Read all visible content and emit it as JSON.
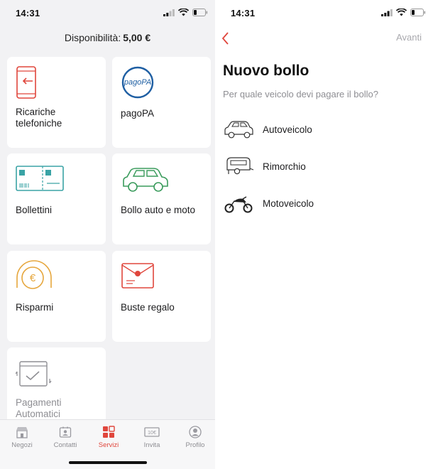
{
  "left_screen": {
    "status_bar": {
      "time": "14:31"
    },
    "balance": {
      "label": "Disponibilità:",
      "amount": "5,00 €"
    },
    "services": [
      {
        "id": "ricariche",
        "label_line1": "Ricariche",
        "label_line2": "telefoniche",
        "icon": "phone-recharge-icon"
      },
      {
        "id": "pagopa",
        "label": "pagoPA",
        "icon": "pagopa-logo",
        "logo_text": "pagoPA"
      },
      {
        "id": "bollettini",
        "label": "Bollettini",
        "icon": "bill-slip-icon"
      },
      {
        "id": "bollo",
        "label": "Bollo auto e moto",
        "icon": "car-icon"
      },
      {
        "id": "risparmi",
        "label": "Risparmi",
        "icon": "euro-coin-icon"
      },
      {
        "id": "buste",
        "label": "Buste regalo",
        "icon": "gift-envelope-icon"
      },
      {
        "id": "pagamenti",
        "label_line1": "Pagamenti",
        "label_line2": "Automatici",
        "icon": "automatic-payment-icon"
      }
    ],
    "tabs": [
      {
        "label": "Negozi",
        "icon": "store-icon"
      },
      {
        "label": "Contatti",
        "icon": "contacts-icon"
      },
      {
        "label": "Servizi",
        "icon": "services-grid-icon",
        "active": true
      },
      {
        "label": "Invita",
        "icon": "invite-ticket-icon",
        "icon_text": "10€"
      },
      {
        "label": "Profilo",
        "icon": "profile-icon"
      }
    ],
    "colors": {
      "accent": "#e0463c",
      "teal": "#3aa3a5",
      "green": "#3a9b5c",
      "gold": "#e6a63c",
      "pagopa_blue": "#1f5fa3"
    }
  },
  "right_screen": {
    "status_bar": {
      "time": "14:31"
    },
    "nav": {
      "back_icon": "chevron-left-icon",
      "next_label": "Avanti"
    },
    "title": "Nuovo bollo",
    "subtitle": "Per quale veicolo devi pagare il bollo?",
    "vehicles": [
      {
        "label": "Autoveicolo",
        "icon": "car-outline-icon"
      },
      {
        "label": "Rimorchio",
        "icon": "trailer-outline-icon"
      },
      {
        "label": "Motoveicolo",
        "icon": "motorcycle-outline-icon"
      }
    ]
  }
}
